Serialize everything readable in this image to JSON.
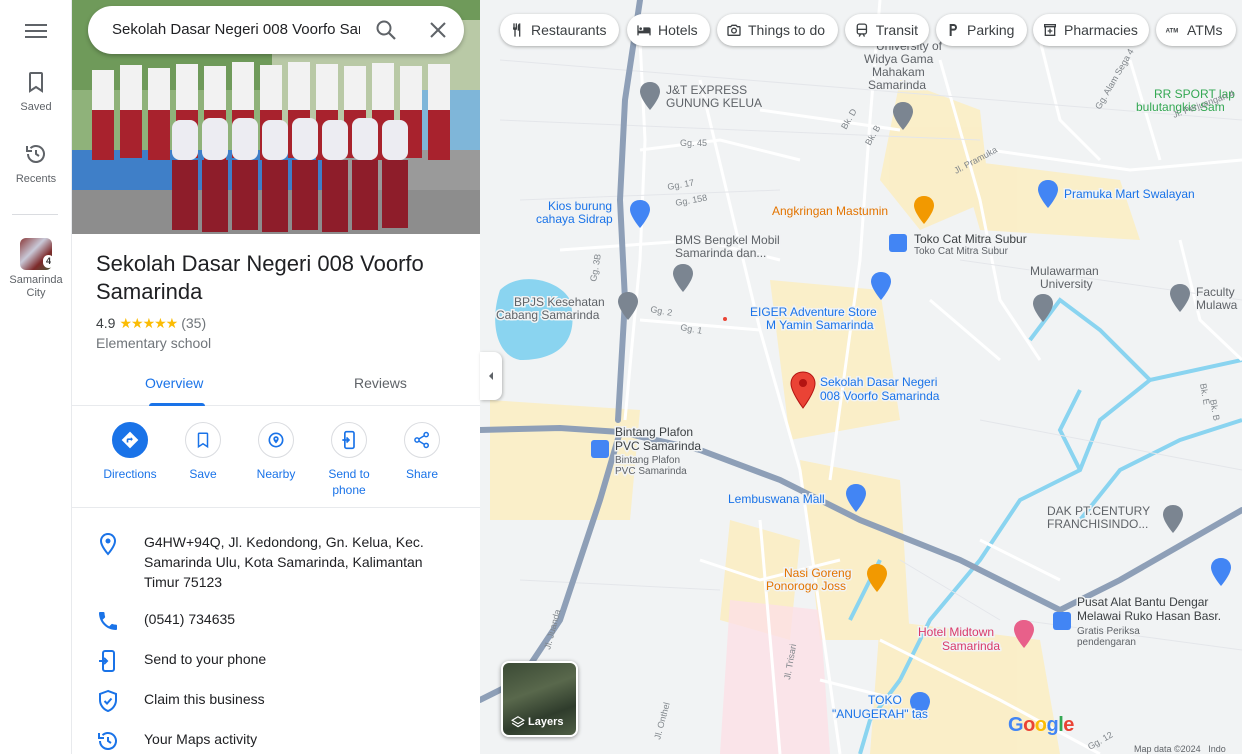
{
  "rail": {
    "saved_label": "Saved",
    "recents_label": "Recents",
    "recent_place_label": "Samarinda City",
    "recent_place_count": "4"
  },
  "search": {
    "query": "Sekolah Dasar Negeri 008 Voorfo Samarinda"
  },
  "place": {
    "name": "Sekolah Dasar Negeri 008 Voorfo Samarinda",
    "rating": "4.9",
    "stars": "★★★★★",
    "review_count": "(35)",
    "category": "Elementary school"
  },
  "tabs": [
    {
      "label": "Overview",
      "active": true
    },
    {
      "label": "Reviews",
      "active": false
    }
  ],
  "actions": [
    {
      "label": "Directions",
      "icon": "directions-icon"
    },
    {
      "label": "Save",
      "icon": "bookmark-icon"
    },
    {
      "label": "Nearby",
      "icon": "nearby-icon"
    },
    {
      "label": "Send to phone",
      "icon": "send-to-phone-icon"
    },
    {
      "label": "Share",
      "icon": "share-icon"
    }
  ],
  "info": {
    "address": "G4HW+94Q, Jl. Kedondong, Gn. Kelua, Kec. Samarinda Ulu, Kota Samarinda, Kalimantan Timur 75123",
    "phone": "(0541) 734635",
    "send_to_phone": "Send to your phone",
    "claim": "Claim this business",
    "activity": "Your Maps activity"
  },
  "chips": [
    {
      "label": "Restaurants",
      "icon": "fork-knife-icon"
    },
    {
      "label": "Hotels",
      "icon": "bed-icon"
    },
    {
      "label": "Things to do",
      "icon": "camera-icon"
    },
    {
      "label": "Transit",
      "icon": "train-icon"
    },
    {
      "label": "Parking",
      "icon": "parking-icon"
    },
    {
      "label": "Pharmacies",
      "icon": "pharmacy-icon"
    },
    {
      "label": "ATMs",
      "icon": "atm-icon"
    }
  ],
  "map": {
    "layers_label": "Layers",
    "google_logo": "Google",
    "map_data": "Map data ©2024",
    "map_data_tail": "Indo",
    "selected_place": "Sekolah Dasar Negeri 008 Voorfo Samarinda",
    "places": [
      {
        "name": "J&T EXPRESS GUNUNG KELUA",
        "type": "generic"
      },
      {
        "name": "University of Widya Gama Mahakam Samarinda",
        "type": "school"
      },
      {
        "name": "RR SPORT lap bulutangkis Sam",
        "type": "park"
      },
      {
        "name": "Kios burung cahaya Sidrap",
        "type": "shop"
      },
      {
        "name": "Pramuka Mart Swalayan",
        "type": "shop"
      },
      {
        "name": "Angkringan Mastumin",
        "type": "food"
      },
      {
        "name": "Toko Cat Mitra Subur",
        "type": "shop",
        "sub": "Toko Cat Mitra Subur"
      },
      {
        "name": "BMS Bengkel Mobil Samarinda dan...",
        "type": "generic"
      },
      {
        "name": "Mulawarman University",
        "type": "school"
      },
      {
        "name": "Faculty Mulawa",
        "type": "school"
      },
      {
        "name": "BPJS Kesehatan Cabang Samarinda",
        "type": "gov"
      },
      {
        "name": "EIGER Adventure Store M Yamin Samarinda",
        "type": "shop"
      },
      {
        "name": "Bintang Plafon PVC Samarinda",
        "type": "shop",
        "sub": "Bintang Plafon PVC Samarinda"
      },
      {
        "name": "Lembuswana Mall",
        "type": "shop"
      },
      {
        "name": "DAK PT.CENTURY FRANCHISINDO...",
        "type": "generic"
      },
      {
        "name": "Nasi Goreng Ponorogo Joss",
        "type": "food"
      },
      {
        "name": "Pusat Alat Bantu Dengar Melawai Ruko Hasan Basr.",
        "type": "shop",
        "sub": "Gratis Periksa pendengaran"
      },
      {
        "name": "Hotel Midtown Samarinda",
        "type": "hotel"
      },
      {
        "name": "TOKO \"ANUGERAH\" tas",
        "type": "shop"
      }
    ],
    "streets": [
      "Jl. Pramuka",
      "Gg. 45",
      "Gg. 17",
      "Gg. 158",
      "Gg. 3B",
      "Gg. 2",
      "Gg. 1",
      "Bk. D",
      "Bk. B",
      "Gg. Alam Sega 4",
      "Jl. Perjuangan 4",
      "Jl. Juanda",
      "Jl. Onthel",
      "Jl. Trisari",
      "Gg. 12",
      "Bk. E",
      "Bk. B"
    ]
  },
  "colors": {
    "accent": "#1a73e8",
    "map_bg": "#f1f3f4",
    "road_major": "#8e9fb7",
    "road_minor": "#ffffff",
    "water": "#8ad4f0",
    "area_yellow": "#fbeec4",
    "label_blue": "#1a73e8",
    "label_orange": "#e37400",
    "label_pink": "#d93a6b",
    "pin_red": "#ea4335"
  }
}
